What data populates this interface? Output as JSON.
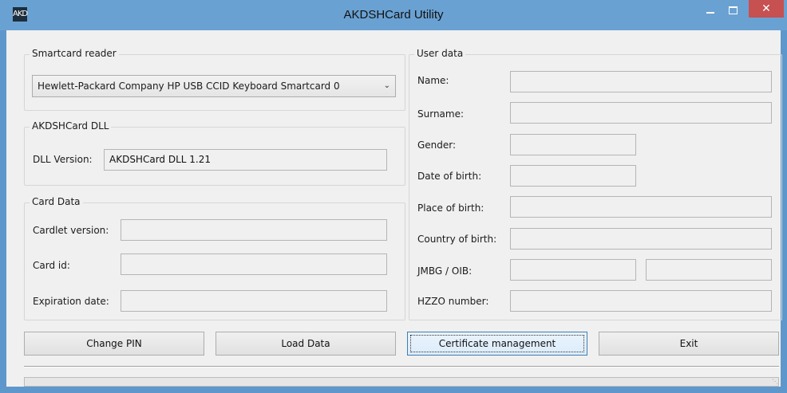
{
  "window": {
    "title": "AKDSHCard Utility",
    "icon_text": "AKD"
  },
  "title_buttons": {
    "minimize": "minimize-icon",
    "maximize": "maximize-icon",
    "close_glyph": "✕"
  },
  "smartcard_reader": {
    "group_title": "Smartcard reader",
    "selected": "Hewlett-Packard Company HP USB CCID Keyboard Smartcard  0"
  },
  "dll": {
    "group_title": "AKDSHCard DLL",
    "version_label": "DLL Version:",
    "version_value": "AKDSHCard DLL 1.21"
  },
  "card_data": {
    "group_title": "Card Data",
    "cardlet_label": "Cardlet version:",
    "cardlet_value": "",
    "card_id_label": "Card id:",
    "card_id_value": "",
    "expiration_label": "Expiration date:",
    "expiration_value": ""
  },
  "user_data": {
    "group_title": "User data",
    "name_label": "Name:",
    "name_value": "",
    "surname_label": "Surname:",
    "surname_value": "",
    "gender_label": "Gender:",
    "gender_value": "",
    "dob_label": "Date of birth:",
    "dob_value": "",
    "pob_label": "Place of birth:",
    "pob_value": "",
    "cob_label": "Country of birth:",
    "cob_value": "",
    "jmbg_label": "JMBG / OIB:",
    "jmbg_value": "",
    "oib_value": "",
    "hzzo_label": "HZZO number:",
    "hzzo_value": ""
  },
  "buttons": {
    "change_pin": "Change PIN",
    "load_data": "Load Data",
    "certificate_management": "Certificate management",
    "exit": "Exit"
  },
  "progress": {
    "percent": 0
  },
  "colors": {
    "titlebar": "#6aa1d3",
    "close": "#c75050",
    "client": "#f0f0f0"
  }
}
